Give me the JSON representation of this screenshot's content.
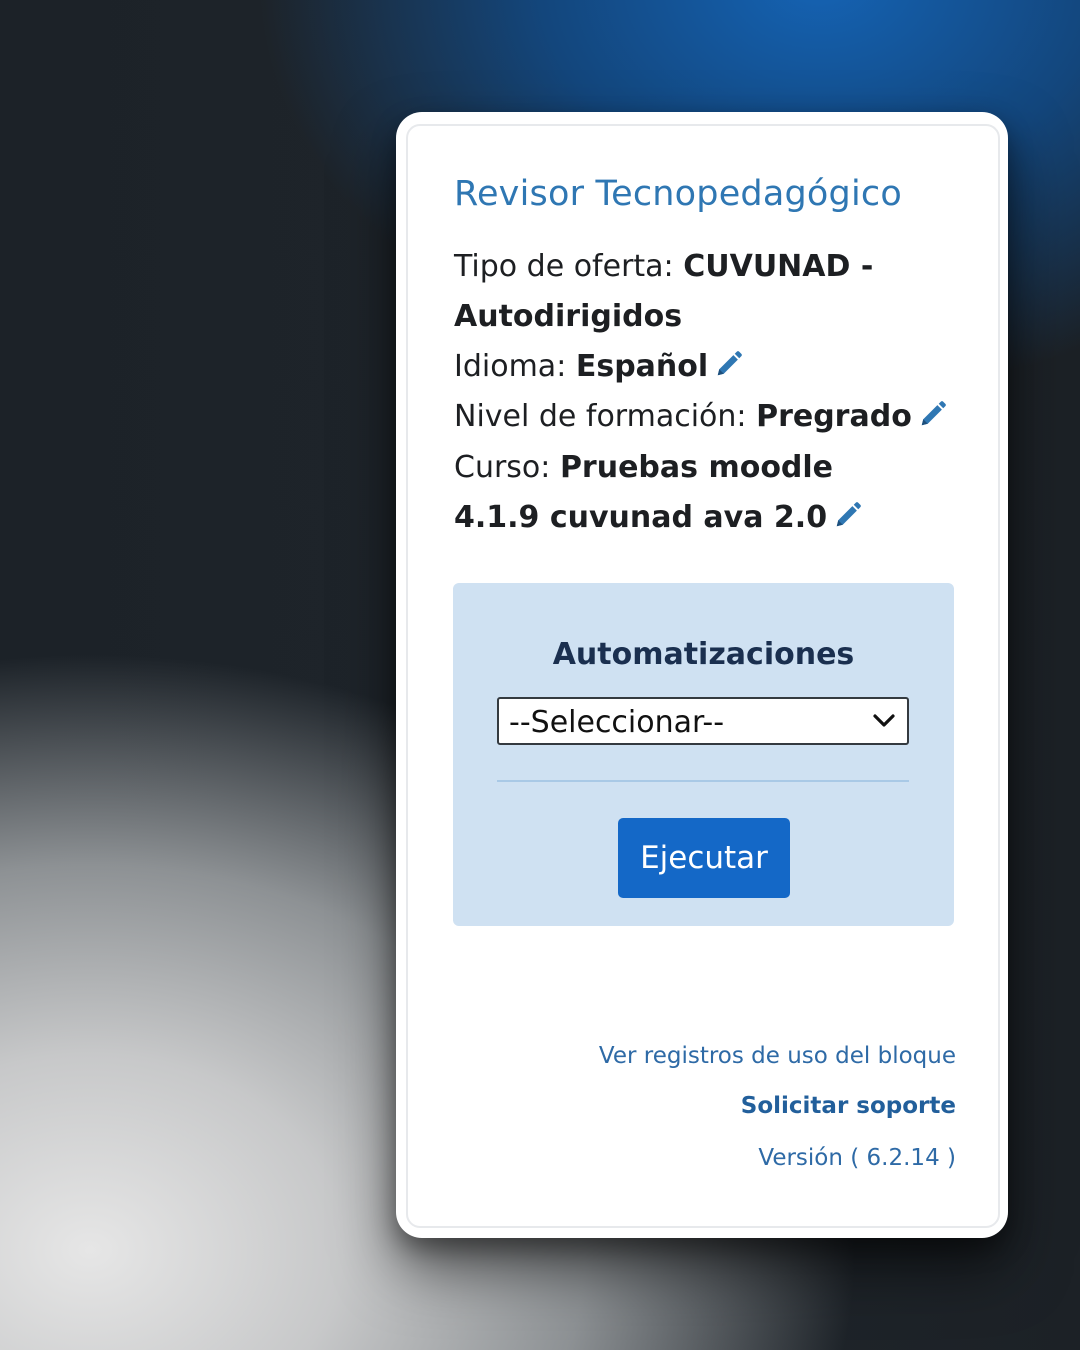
{
  "block": {
    "title": "Revisor Tecnopedagógico",
    "offer_label": "Tipo de oferta: ",
    "offer_value": "CUVUNAD - Autodirigidos",
    "language_label": "Idioma: ",
    "language_value": "Español",
    "level_label": "Nivel de formación: ",
    "level_value": "Pregrado",
    "course_label": "Curso: ",
    "course_value": "Pruebas moodle 4.1.9 cuvunad ava 2.0"
  },
  "automations": {
    "title": "Automatizaciones",
    "select_value": "--Seleccionar--",
    "run_label": "Ejecutar"
  },
  "footer": {
    "logs_link": "Ver registros de uso del bloque",
    "support_link": "Solicitar soporte",
    "version_text": "Versión ( 6.2.14 )"
  },
  "colors": {
    "title": "#2f77b3",
    "panel_bg": "#cfe1f2",
    "button_bg": "#1468c7",
    "pencil": "#2f77b3"
  },
  "icons": {
    "edit": "pencil-icon",
    "dropdown": "chevron-down-icon"
  }
}
